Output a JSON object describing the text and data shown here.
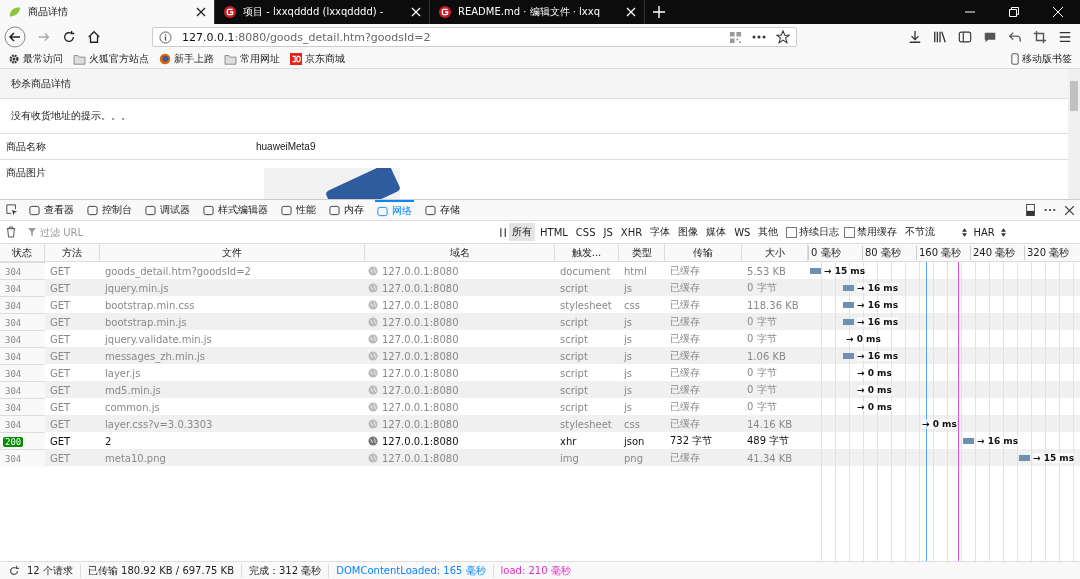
{
  "browser_tabs": [
    {
      "title": "商品详情",
      "selected": true,
      "kind": "leaf"
    },
    {
      "title": "项目 - lxxqdddd (lxxqdddd) -",
      "selected": false,
      "kind": "gitee"
    },
    {
      "title": "README.md · 编辑文件 · lxxq",
      "selected": false,
      "kind": "gitee"
    }
  ],
  "address": {
    "host": "127.0.0.1",
    "rest": ":8080/goods_detail.htm?goodsId=2"
  },
  "bookmarks": [
    {
      "label": "最常访问",
      "kind": "gear"
    },
    {
      "label": "火狐官方站点",
      "kind": "folder"
    },
    {
      "label": "新手上路",
      "kind": "globe"
    },
    {
      "label": "常用网址",
      "kind": "folder"
    },
    {
      "label": "京东商城",
      "kind": "jd"
    }
  ],
  "mobile_bookmarks": "移动版书签",
  "page": {
    "panel_title": "秒杀商品详情",
    "notice": "没有收货地址的提示。。。",
    "fields": [
      {
        "label": "商品名称",
        "kind": "text",
        "value": "huaweiMeta9"
      },
      {
        "label": "商品图片",
        "kind": "image"
      }
    ]
  },
  "devtools": {
    "tabs": [
      {
        "label": "查看器",
        "selected": false
      },
      {
        "label": "控制台",
        "selected": false
      },
      {
        "label": "调试器",
        "selected": false
      },
      {
        "label": "样式编辑器",
        "selected": false
      },
      {
        "label": "性能",
        "selected": false
      },
      {
        "label": "内存",
        "selected": false
      },
      {
        "label": "网络",
        "selected": true
      },
      {
        "label": "存储",
        "selected": false
      }
    ],
    "filter_placeholder": "过滤 URL",
    "type_filters": [
      {
        "label": "所有",
        "selected": true
      },
      {
        "label": "HTML",
        "selected": false
      },
      {
        "label": "CSS",
        "selected": false
      },
      {
        "label": "JS",
        "selected": false
      },
      {
        "label": "XHR",
        "selected": false
      },
      {
        "label": "字体",
        "selected": false
      },
      {
        "label": "图像",
        "selected": false
      },
      {
        "label": "媒体",
        "selected": false
      },
      {
        "label": "WS",
        "selected": false
      },
      {
        "label": "其他",
        "selected": false
      }
    ],
    "options": [
      {
        "label": "持续日志",
        "checked": false
      },
      {
        "label": "禁用缓存",
        "checked": false
      }
    ],
    "throttle": "不节流",
    "har": "HAR",
    "columns": [
      "状态",
      "方法",
      "文件",
      "域名",
      "触发...",
      "类型",
      "传输",
      "大小"
    ],
    "timeline_ticks": [
      "0 毫秒",
      "80 毫秒",
      "160 毫秒",
      "240 毫秒",
      "320 毫秒"
    ],
    "requests": [
      {
        "status": "304",
        "kind": "cached",
        "method": "GET",
        "file": "goods_detail.htm?goodsId=2",
        "domain": "127.0.0.1:8080",
        "cause": "document",
        "type": "html",
        "transferred": "已缓存",
        "size": "5.53 KB",
        "timing": "→ 15 ms"
      },
      {
        "status": "304",
        "kind": "cached",
        "method": "GET",
        "file": "jquery.min.js",
        "domain": "127.0.0.1:8080",
        "cause": "script",
        "type": "js",
        "transferred": "已缓存",
        "size": "0 字节",
        "timing": "→ 16 ms"
      },
      {
        "status": "304",
        "kind": "cached",
        "method": "GET",
        "file": "bootstrap.min.css",
        "domain": "127.0.0.1:8080",
        "cause": "stylesheet",
        "type": "css",
        "transferred": "已缓存",
        "size": "118.36 KB",
        "timing": "→ 16 ms"
      },
      {
        "status": "304",
        "kind": "cached",
        "method": "GET",
        "file": "bootstrap.min.js",
        "domain": "127.0.0.1:8080",
        "cause": "script",
        "type": "js",
        "transferred": "已缓存",
        "size": "0 字节",
        "timing": "→ 16 ms"
      },
      {
        "status": "304",
        "kind": "cached",
        "method": "GET",
        "file": "jquery.validate.min.js",
        "domain": "127.0.0.1:8080",
        "cause": "script",
        "type": "js",
        "transferred": "已缓存",
        "size": "0 字节",
        "timing": "→ 0 ms"
      },
      {
        "status": "304",
        "kind": "cached",
        "method": "GET",
        "file": "messages_zh.min.js",
        "domain": "127.0.0.1:8080",
        "cause": "script",
        "type": "js",
        "transferred": "已缓存",
        "size": "1.06 KB",
        "timing": "→ 16 ms"
      },
      {
        "status": "304",
        "kind": "cached",
        "method": "GET",
        "file": "layer.js",
        "domain": "127.0.0.1:8080",
        "cause": "script",
        "type": "js",
        "transferred": "已缓存",
        "size": "0 字节",
        "timing": "→ 0 ms"
      },
      {
        "status": "304",
        "kind": "cached",
        "method": "GET",
        "file": "md5.min.js",
        "domain": "127.0.0.1:8080",
        "cause": "script",
        "type": "js",
        "transferred": "已缓存",
        "size": "0 字节",
        "timing": "→ 0 ms"
      },
      {
        "status": "304",
        "kind": "cached",
        "method": "GET",
        "file": "common.js",
        "domain": "127.0.0.1:8080",
        "cause": "script",
        "type": "js",
        "transferred": "已缓存",
        "size": "0 字节",
        "timing": "→ 0 ms"
      },
      {
        "status": "304",
        "kind": "cached",
        "method": "GET",
        "file": "layer.css?v=3.0.3303",
        "domain": "127.0.0.1:8080",
        "cause": "stylesheet",
        "type": "css",
        "transferred": "已缓存",
        "size": "14.16 KB",
        "timing": "→ 0 ms"
      },
      {
        "status": "200",
        "kind": "fresh",
        "method": "GET",
        "file": "2",
        "domain": "127.0.0.1:8080",
        "cause": "xhr",
        "type": "json",
        "transferred": "732 字节",
        "size": "489 字节",
        "timing": "→ 16 ms"
      },
      {
        "status": "304",
        "kind": "cached",
        "method": "GET",
        "file": "meta10.png",
        "domain": "127.0.0.1:8080",
        "cause": "img",
        "type": "png",
        "transferred": "已缓存",
        "size": "41.34 KB",
        "timing": "→ 15 ms"
      }
    ]
  },
  "status_bar": {
    "requests": "12 个请求",
    "transferred": "已传输 180.92 KB / 697.75 KB",
    "finish": "完成：312 毫秒",
    "dom_loaded": "DOMContentLoaded: 165 毫秒",
    "load": "load: 210 毫秒"
  }
}
